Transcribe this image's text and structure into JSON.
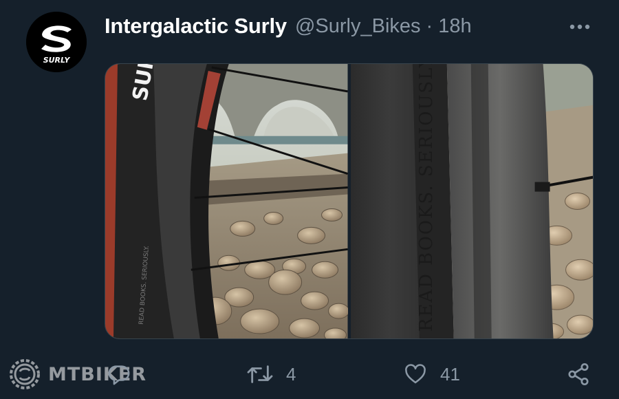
{
  "tweet": {
    "display_name": "Intergalactic Surly",
    "handle": "@Surly_Bikes",
    "separator": "·",
    "time": "18h",
    "avatar_icon": "surly-logo",
    "avatar_text": "SURLY",
    "media": [
      {
        "description_icon": "fat-bike-wheel-photo",
        "tire_text": "SUR",
        "sidewall_text": "READ BOOKS. SERIOUSLY."
      },
      {
        "description_icon": "tire-sidewall-closeup-photo",
        "sidewall_text": "READ BOOKS. SERIOUSLY."
      }
    ]
  },
  "actions": {
    "reply_count": "",
    "retweet_count": "4",
    "like_count": "41",
    "icons": [
      "reply-icon",
      "retweet-icon",
      "like-icon",
      "share-icon"
    ]
  },
  "watermark": {
    "text": "MTBIKER"
  },
  "colors": {
    "background": "#15202b",
    "primary_text": "#ffffff",
    "secondary_text": "#8b98a5"
  }
}
